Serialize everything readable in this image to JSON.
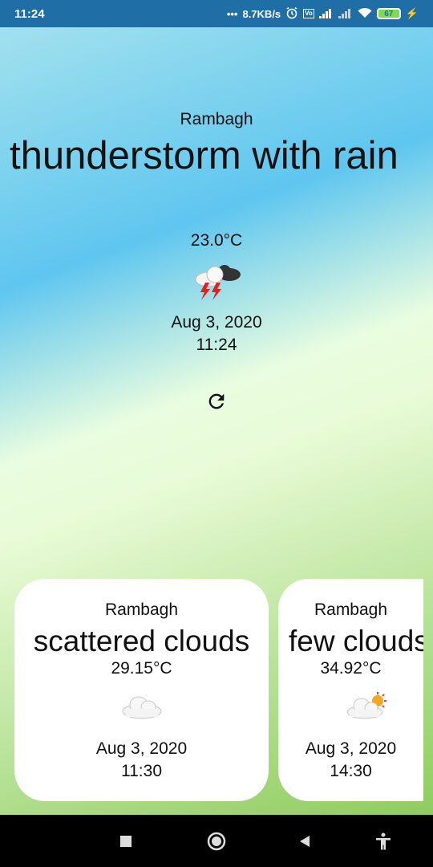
{
  "status_bar": {
    "time": "11:24",
    "net_speed": "8.7KB/s",
    "battery": "67"
  },
  "current": {
    "city": "Rambagh",
    "description": "thunderstorm with rain",
    "temperature": "23.0°C",
    "icon": "thunderstorm-icon",
    "date": "Aug 3, 2020",
    "time": "11:24"
  },
  "refresh_icon": "refresh-icon",
  "forecast": [
    {
      "city": "Rambagh",
      "description": "scattered clouds",
      "temperature": "29.15°C",
      "icon": "cloud-icon",
      "date": "Aug 3, 2020",
      "time": "11:30"
    },
    {
      "city": "Rambagh",
      "description": "few clouds",
      "temperature": "34.92°C",
      "icon": "partly-cloudy-icon",
      "date": "Aug 3, 2020",
      "time": "14:30"
    }
  ],
  "colors": {
    "status_bar": "#1f6fa6",
    "gradient_top": "#5fc6ef",
    "gradient_bottom": "#8fcc5e",
    "card": "#ffffff"
  }
}
